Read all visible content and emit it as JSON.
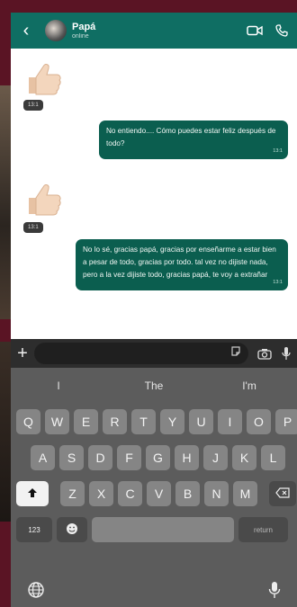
{
  "header": {
    "back_icon": "back-arrow-icon",
    "name": "Papá",
    "status": "online",
    "video_icon": "video-camera-icon",
    "call_icon": "phone-icon",
    "color": "#0f6e63"
  },
  "messages": [
    {
      "type": "sticker",
      "emoji": "👍🏻",
      "time": "13:1"
    },
    {
      "type": "sent",
      "text": "No entiendo.... Cómo puedes estar feliz después de todo?",
      "time": "13:1"
    },
    {
      "type": "sticker",
      "emoji": "👍🏻",
      "time": "13:1"
    },
    {
      "type": "sent",
      "text": "No lo sé, gracias papá, gracias por enseñarme a estar bien a pesar de todo, gracias por todo. tal vez no dijiste nada, pero a la vez dijiste todo, gracias papá, te voy a extrañar",
      "time": "13:1"
    }
  ],
  "input": {
    "plus_icon": "plus-icon",
    "sticker_icon": "sticker-icon",
    "camera_icon": "camera-icon",
    "mic_icon": "microphone-icon"
  },
  "keyboard": {
    "suggestions": [
      "I",
      "The",
      "I'm"
    ],
    "row1": [
      "Q",
      "W",
      "E",
      "R",
      "T",
      "Y",
      "U",
      "I",
      "O",
      "P"
    ],
    "row2": [
      "A",
      "S",
      "D",
      "F",
      "G",
      "H",
      "J",
      "K",
      "L"
    ],
    "row3": [
      "Z",
      "X",
      "C",
      "V",
      "B",
      "N",
      "M"
    ],
    "numbers_label": "123",
    "return_label": "return",
    "shift_icon": "shift-icon",
    "delete_icon": "delete-icon",
    "emoji_icon": "emoji-icon",
    "globe_icon": "globe-icon",
    "dictation_icon": "microphone-icon"
  }
}
